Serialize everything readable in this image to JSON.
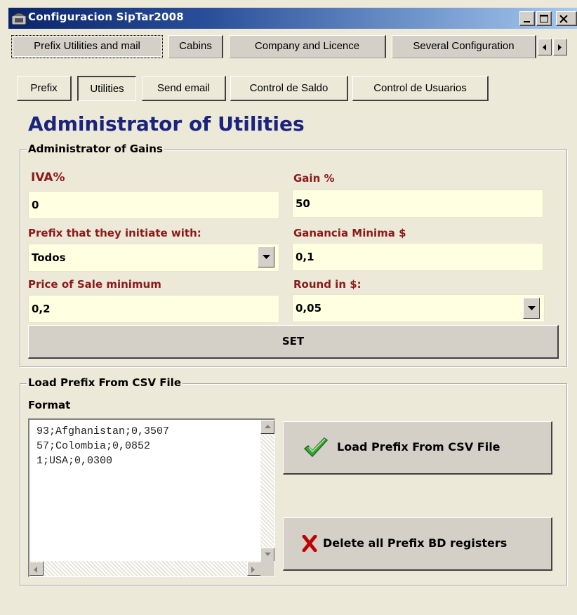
{
  "window": {
    "title": "Configuracion SipTar2008"
  },
  "tabs": [
    {
      "label": "Prefix Utilities and mail"
    },
    {
      "label": "Cabins"
    },
    {
      "label": "Company and Licence"
    },
    {
      "label": "Several Configuration"
    }
  ],
  "subtabs": [
    {
      "label": "Prefix"
    },
    {
      "label": "Utilities"
    },
    {
      "label": "Send email"
    },
    {
      "label": "Control de Saldo"
    },
    {
      "label": "Control de Usuarios"
    }
  ],
  "heading": "Administrator of Utilities",
  "gains": {
    "group_title": "Administrator of Gains",
    "iva_label": "IVA%",
    "iva_value": "0",
    "gain_label": "Gain %",
    "gain_value": "50",
    "prefix_label": "Prefix that they initiate with:",
    "prefix_value": "Todos",
    "min_gain_label": "Ganancia Minima $",
    "min_gain_value": "0,1",
    "min_price_label": "Price of Sale  minimum",
    "min_price_value": "0,2",
    "round_label": "Round in $:",
    "round_value": "0,05",
    "set_label": "SET"
  },
  "csv": {
    "group_title": "Load Prefix From CSV File",
    "format_label": "Format",
    "lines": [
      "93;Afghanistan;0,3507",
      "57;Colombia;0,0852",
      "1;USA;0,0300"
    ],
    "load_label": "Load Prefix From CSV File",
    "delete_label": "Delete all Prefix BD registers"
  },
  "colors": {
    "label": "#8b1a1a",
    "heading": "#1a237e",
    "field_bg": "#ffffe1",
    "title_bar": "#0a246a"
  }
}
